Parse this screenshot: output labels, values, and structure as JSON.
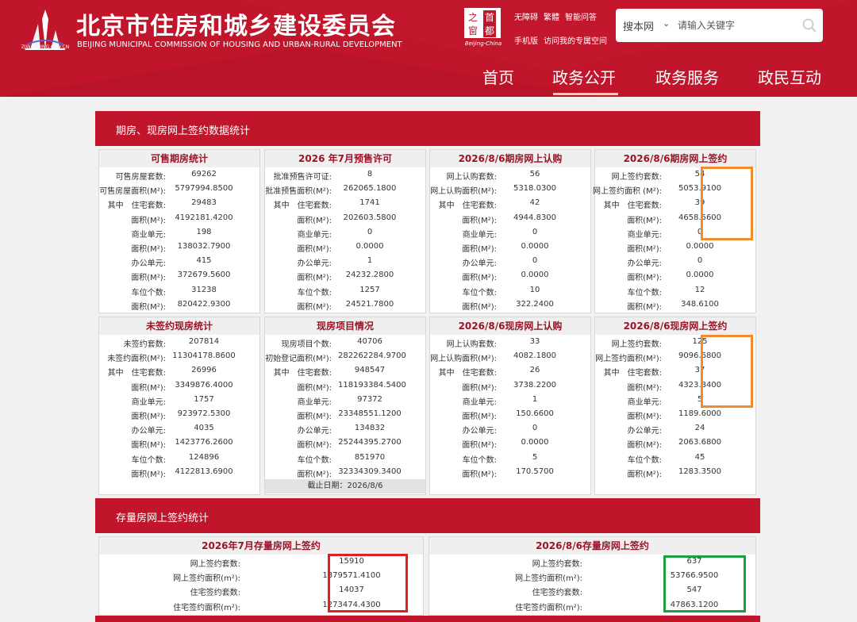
{
  "header": {
    "logo_url_text": "ZJW.BEIJING.GOV.CN",
    "title": "北京市住房和城乡建设委员会",
    "subtitle": "BEIJING MUNICIPAL COMMISSION OF HOUSING AND URBAN-RURAL DEVELOPMENT",
    "seal_chars": [
      "之",
      "首",
      "窗",
      "都"
    ],
    "seal_caption": "Beijing-China",
    "util_links": [
      "无障碍",
      "繁體",
      "智能问答",
      "手机版",
      "访问我的专属空间"
    ],
    "search": {
      "scope": "搜本网",
      "placeholder": "请输入关键字"
    },
    "nav": [
      "首页",
      "政务公开",
      "政务服务",
      "政民互动"
    ],
    "brand_color": "#c0152a"
  },
  "sections": {
    "section1_title": "期房、现房网上签约数据统计",
    "section2_title": "存量房网上签约统计"
  },
  "panels": [
    {
      "title": "可售期房统计",
      "rows": [
        [
          "可售房屋套数:",
          "69262"
        ],
        [
          "可售房屋面积(M²):",
          "5797994.8500"
        ],
        [
          "其中　住宅套数:",
          "29483"
        ],
        [
          "面积(M²):",
          "4192181.4200"
        ],
        [
          "商业单元:",
          "198"
        ],
        [
          "面积(M²):",
          "138032.7900"
        ],
        [
          "办公单元:",
          "415"
        ],
        [
          "面积(M²):",
          "372679.5600"
        ],
        [
          "车位个数:",
          "31238"
        ],
        [
          "面积(M²):",
          "820422.9300"
        ]
      ]
    },
    {
      "title": "2026 年7月预售许可",
      "rows": [
        [
          "批准预售许可证:",
          "8"
        ],
        [
          "批准预售面积(M²):",
          "262065.1800"
        ],
        [
          "其中　住宅套数:",
          "1741"
        ],
        [
          "面积(M²):",
          "202603.5800"
        ],
        [
          "商业单元:",
          "0"
        ],
        [
          "面积(M²):",
          "0.0000"
        ],
        [
          "办公单元:",
          "1"
        ],
        [
          "面积(M²):",
          "24232.2800"
        ],
        [
          "车位个数:",
          "1257"
        ],
        [
          "面积(M²):",
          "24521.7800"
        ]
      ]
    },
    {
      "title": "2026/8/6期房网上认购",
      "rows": [
        [
          "网上认购套数:",
          "56"
        ],
        [
          "网上认购面积(M²):",
          "5318.0300"
        ],
        [
          "其中　住宅套数:",
          "42"
        ],
        [
          "面积(M²):",
          "4944.8300"
        ],
        [
          "商业单元:",
          "0"
        ],
        [
          "面积(M²):",
          "0.0000"
        ],
        [
          "办公单元:",
          "0"
        ],
        [
          "面积(M²):",
          "0.0000"
        ],
        [
          "车位个数:",
          "10"
        ],
        [
          "面积(M²):",
          "322.2400"
        ]
      ]
    },
    {
      "title": "2026/8/6期房网上签约",
      "rows": [
        [
          "网上签约套数:",
          "54"
        ],
        [
          "网上签约面积 (M²):",
          "5053.9100"
        ],
        [
          "其中　住宅套数:",
          "39"
        ],
        [
          "面积(M²):",
          "4658.5600"
        ],
        [
          "商业单元:",
          "0"
        ],
        [
          "面积(M²):",
          "0.0000"
        ],
        [
          "办公单元:",
          "0"
        ],
        [
          "面积(M²):",
          "0.0000"
        ],
        [
          "车位个数:",
          "12"
        ],
        [
          "面积(M²):",
          "348.6100"
        ]
      ]
    },
    {
      "title": "未签约现房统计",
      "rows": [
        [
          "未签约套数:",
          "207814"
        ],
        [
          "未签约面积(M²):",
          "11304178.8600"
        ],
        [
          "其中　住宅套数:",
          "26996"
        ],
        [
          "面积(M²):",
          "3349876.4000"
        ],
        [
          "商业单元:",
          "1757"
        ],
        [
          "面积(M²):",
          "923972.5300"
        ],
        [
          "办公单元:",
          "4035"
        ],
        [
          "面积(M²):",
          "1423776.2600"
        ],
        [
          "车位个数:",
          "124896"
        ],
        [
          "面积(M²):",
          "4122813.6900"
        ]
      ]
    },
    {
      "title": "现房项目情况",
      "rows": [
        [
          "现房项目个数:",
          "40706"
        ],
        [
          "初始登记面积(M²):",
          "282262284.9700"
        ],
        [
          "其中　住宅套数:",
          "948547"
        ],
        [
          "面积(M²):",
          "118193384.5400"
        ],
        [
          "商业单元:",
          "97372"
        ],
        [
          "面积(M²):",
          "23348551.1200"
        ],
        [
          "办公单元:",
          "134832"
        ],
        [
          "面积(M²):",
          "25244395.2700"
        ],
        [
          "车位个数:",
          "851970"
        ],
        [
          "面积(M²):",
          "32334309.3400"
        ]
      ],
      "footer": "截止日期：2026/8/6"
    },
    {
      "title": "2026/8/6现房网上认购",
      "rows": [
        [
          "网上认购套数:",
          "33"
        ],
        [
          "网上认购面积(M²):",
          "4082.1800"
        ],
        [
          "其中　住宅套数:",
          "26"
        ],
        [
          "面积(M²):",
          "3738.2200"
        ],
        [
          "商业单元:",
          "1"
        ],
        [
          "面积(M²):",
          "150.6600"
        ],
        [
          "办公单元:",
          "0"
        ],
        [
          "面积(M²):",
          "0.0000"
        ],
        [
          "车位个数:",
          "5"
        ],
        [
          "面积(M²):",
          "170.5700"
        ]
      ]
    },
    {
      "title": "2026/8/6现房网上签约",
      "rows": [
        [
          "网上签约套数:",
          "125"
        ],
        [
          "网上签约面积(M²):",
          "9096.6800"
        ],
        [
          "其中　住宅套数:",
          "37"
        ],
        [
          "面积(M²):",
          "4323.8400"
        ],
        [
          "商业单元:",
          "5"
        ],
        [
          "面积(M²):",
          "1189.6000"
        ],
        [
          "办公单元:",
          "24"
        ],
        [
          "面积(M²):",
          "2063.6800"
        ],
        [
          "车位个数:",
          "45"
        ],
        [
          "面积(M²):",
          "1283.3500"
        ]
      ]
    },
    {
      "title": "2026年7月存量房网上签约",
      "rows": [
        [
          "网上签约套数:",
          "15910"
        ],
        [
          "网上签约面积(m²):",
          "1379571.4100"
        ],
        [
          "住宅签约套数:",
          "14037"
        ],
        [
          "住宅签约面积(m²):",
          "1273474.4300"
        ]
      ]
    },
    {
      "title": "2026/8/6存量房网上签约",
      "rows": [
        [
          "网上签约套数:",
          "637"
        ],
        [
          "网上签约面积(m²):",
          "53766.9500"
        ],
        [
          "住宅签约套数:",
          "547"
        ],
        [
          "住宅签约面积(m²):",
          "47863.1200"
        ]
      ]
    }
  ]
}
